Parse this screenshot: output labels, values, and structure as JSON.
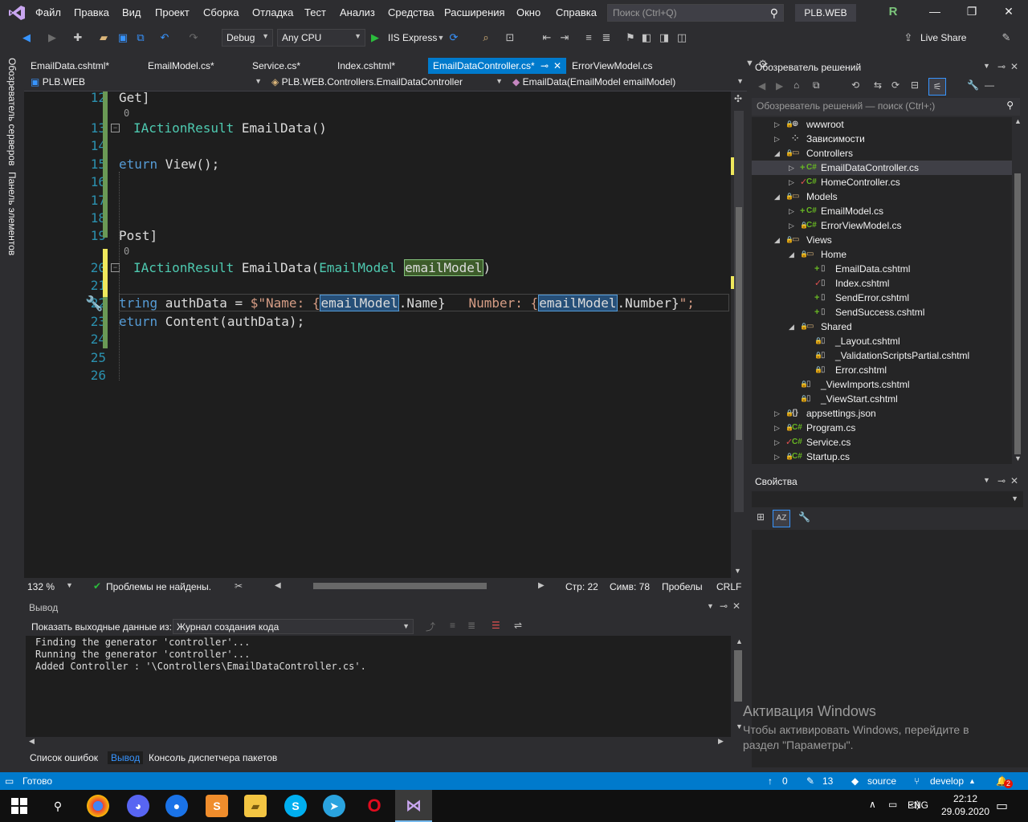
{
  "menu": {
    "items": [
      "Файл",
      "Правка",
      "Вид",
      "Проект",
      "Сборка",
      "Отладка",
      "Тест",
      "Анализ",
      "Средства",
      "Расширения",
      "Окно",
      "Справка"
    ],
    "search_placeholder": "Поиск (Ctrl+Q)",
    "solution_name": "PLB.WEB",
    "avatar_letter": "R"
  },
  "toolbar": {
    "config": "Debug",
    "platform": "Any CPU",
    "run_label": "IIS Express",
    "live_share": "Live Share"
  },
  "left_strip": {
    "server_explorer": "Обозреватель серверов",
    "toolbox": "Панель элементов"
  },
  "doc_tabs": [
    {
      "label": "EmailData.cshtml*"
    },
    {
      "label": "EmailModel.cs*"
    },
    {
      "label": "Service.cs*"
    },
    {
      "label": "Index.cshtml*"
    },
    {
      "label": "EmailDataController.cs*",
      "pin": "⊸",
      "close": "✕"
    },
    {
      "label": "ErrorViewModel.cs"
    }
  ],
  "navbar": {
    "project": "PLB.WEB",
    "class": "PLB.WEB.Controllers.EmailDataController",
    "member": "EmailData(EmailModel emailModel)"
  },
  "editor": {
    "line_numbers": [
      "12",
      "13",
      "14",
      "15",
      "16",
      "17",
      "18",
      "19",
      "20",
      "21",
      "22",
      "23",
      "24",
      "25",
      "26"
    ],
    "lines": {
      "l12": "Get]",
      "l12_refs": "0",
      "l13_type": "IActionResult",
      "l13_rest": " EmailData()",
      "l15_kw": "eturn",
      "l15_rest": " View();",
      "l19": "Post]",
      "l19_refs": "0",
      "l20_type": "IActionResult",
      "l20_name": " EmailData(",
      "l20_ptype": "EmailModel",
      "l20_param": "emailModel",
      "l20_close": ")",
      "l22_kw": "tring",
      "l22_var": " authData = ",
      "l22_str1": "$\"Name: {",
      "l22_ref1": "emailModel",
      "l22_mid1": ".Name}",
      "l22_str2": "   Number: {",
      "l22_ref2": "emailModel",
      "l22_mid2": ".Number}",
      "l22_end": "\";",
      "l23_kw": "eturn",
      "l23_rest": " Content(authData);"
    }
  },
  "editor_status": {
    "zoom": "132 %",
    "problems": "Проблемы не найдены.",
    "line": "Стр: 22",
    "col": "Симв: 78",
    "whitespace": "Пробелы",
    "eol": "CRLF"
  },
  "output": {
    "title": "Вывод",
    "show_from_label": "Показать выходные данные из:",
    "source": "Журнал создания кода",
    "lines": [
      "Finding the generator 'controller'...",
      "Running the generator 'controller'...",
      "Added Controller : '\\Controllers\\EmailDataController.cs'."
    ]
  },
  "bottom_tabs": [
    "Список ошибок",
    "Вывод",
    "Консоль диспетчера пакетов"
  ],
  "solution_explorer": {
    "title": "Обозреватель решений",
    "search_placeholder": "Обозреватель решений — поиск (Ctrl+;)",
    "items": [
      {
        "label": "wwwroot",
        "depth": 0,
        "arrow": "▷",
        "icon": "⊕",
        "status": "lock"
      },
      {
        "label": "Зависимости",
        "depth": 0,
        "arrow": "▷",
        "icon": "⁘",
        "status": ""
      },
      {
        "label": "Controllers",
        "depth": 0,
        "arrow": "◢",
        "icon": "▭",
        "status": "lock"
      },
      {
        "label": "EmailDataController.cs",
        "depth": 1,
        "arrow": "▷",
        "icon": "C#",
        "status": "add",
        "selected": true
      },
      {
        "label": "HomeController.cs",
        "depth": 1,
        "arrow": "▷",
        "icon": "C#",
        "status": "check"
      },
      {
        "label": "Models",
        "depth": 0,
        "arrow": "◢",
        "icon": "▭",
        "status": "lock"
      },
      {
        "label": "EmailModel.cs",
        "depth": 1,
        "arrow": "▷",
        "icon": "C#",
        "status": "add"
      },
      {
        "label": "ErrorViewModel.cs",
        "depth": 1,
        "arrow": "▷",
        "icon": "C#",
        "status": "lock"
      },
      {
        "label": "Views",
        "depth": 0,
        "arrow": "◢",
        "icon": "▭",
        "status": "lock"
      },
      {
        "label": "Home",
        "depth": 1,
        "arrow": "◢",
        "icon": "▭",
        "status": "lock"
      },
      {
        "label": "EmailData.cshtml",
        "depth": 2,
        "arrow": "",
        "icon": "▯",
        "status": "add"
      },
      {
        "label": "Index.cshtml",
        "depth": 2,
        "arrow": "",
        "icon": "▯",
        "status": "check"
      },
      {
        "label": "SendError.cshtml",
        "depth": 2,
        "arrow": "",
        "icon": "▯",
        "status": "add"
      },
      {
        "label": "SendSuccess.cshtml",
        "depth": 2,
        "arrow": "",
        "icon": "▯",
        "status": "add"
      },
      {
        "label": "Shared",
        "depth": 1,
        "arrow": "◢",
        "icon": "▭",
        "status": "lock"
      },
      {
        "label": "_Layout.cshtml",
        "depth": 2,
        "arrow": "",
        "icon": "▯",
        "status": "lock"
      },
      {
        "label": "_ValidationScriptsPartial.cshtml",
        "depth": 2,
        "arrow": "",
        "icon": "▯",
        "status": "lock"
      },
      {
        "label": "Error.cshtml",
        "depth": 2,
        "arrow": "",
        "icon": "▯",
        "status": "lock"
      },
      {
        "label": "_ViewImports.cshtml",
        "depth": 1,
        "arrow": "",
        "icon": "▯",
        "status": "lock"
      },
      {
        "label": "_ViewStart.cshtml",
        "depth": 1,
        "arrow": "",
        "icon": "▯",
        "status": "lock"
      },
      {
        "label": "appsettings.json",
        "depth": 0,
        "arrow": "▷",
        "icon": "{}",
        "status": "lock"
      },
      {
        "label": "Program.cs",
        "depth": 0,
        "arrow": "▷",
        "icon": "C#",
        "status": "lock"
      },
      {
        "label": "Service.cs",
        "depth": 0,
        "arrow": "▷",
        "icon": "C#",
        "status": "check"
      },
      {
        "label": "Startup.cs",
        "depth": 0,
        "arrow": "▷",
        "icon": "C#",
        "status": "lock"
      }
    ]
  },
  "properties": {
    "title": "Свойства"
  },
  "activation": {
    "title": "Активация Windows",
    "text": "Чтобы активировать Windows, перейдите в раздел \"Параметры\"."
  },
  "statusbar": {
    "ready": "Готово",
    "up_count": "0",
    "edit_count": "13",
    "repo": "source",
    "branch": "develop",
    "notifications": "2"
  },
  "taskbar": {
    "lang": "ENG",
    "time": "22:12",
    "date": "29.09.2020"
  },
  "colors": {
    "accent": "#007acc",
    "background": "#2d2d30",
    "editor": "#1e1e1e"
  }
}
